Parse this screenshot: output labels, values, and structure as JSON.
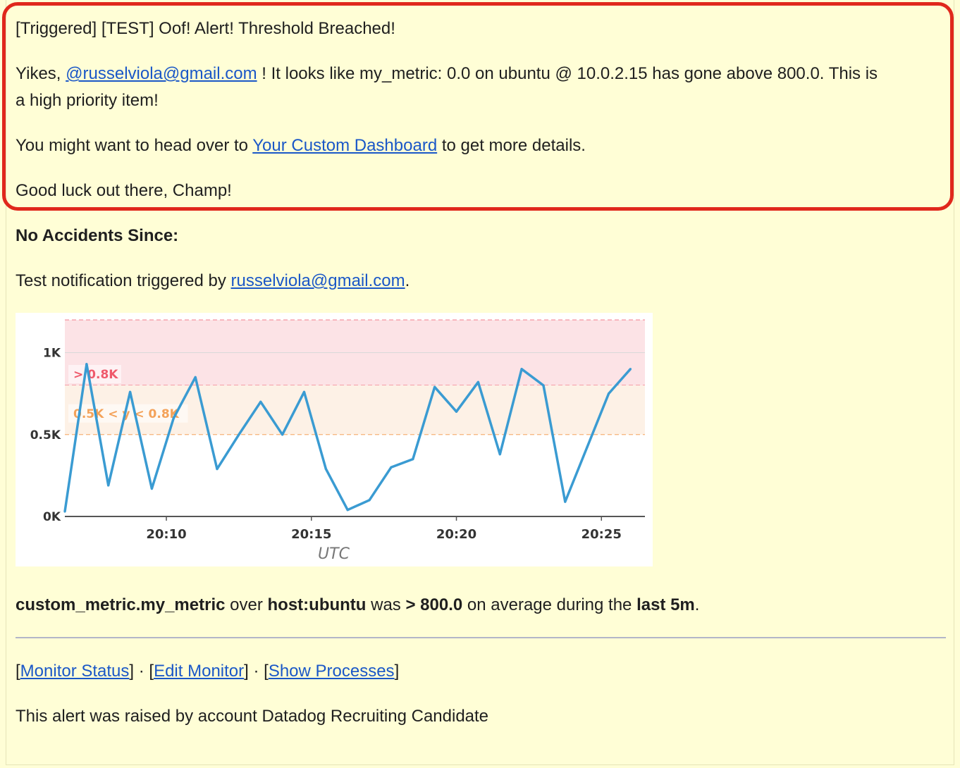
{
  "email": {
    "subject": "[Triggered] [TEST] Oof! Alert! Threshold Breached!",
    "p1_prefix": "Yikes, ",
    "p1_mention": "@russelviola@gmail.com",
    "p1_suffix_a": " ! It looks like my_metric: 0.0 on ubuntu @ 10.0.2.15 has gone above 800.0. This is",
    "p1_suffix_b": "a high priority item!",
    "p2_prefix": "You might want to head over to ",
    "p2_link": "Your Custom Dashboard",
    "p2_suffix": " to get more details.",
    "p3": "Good luck out there, Champ!",
    "heading": "No Accidents Since:",
    "test_prefix": "Test notification triggered by ",
    "test_link": "russelviola@gmail.com",
    "test_suffix": ".",
    "summary": {
      "metric": "custom_metric.my_metric",
      "over": " over ",
      "host": "host:ubuntu",
      "was": " was ",
      "threshold": "> 800.0",
      "on_avg": " on average during the ",
      "window": "last 5m",
      "end": "."
    },
    "links": {
      "open1": "[",
      "monitor_status": "Monitor Status",
      "close1": "] · [",
      "edit_monitor": "Edit Monitor",
      "close2": "] · [",
      "show_processes": "Show Processes",
      "close3": "]"
    },
    "footer": "This alert was raised by account Datadog Recruiting Candidate"
  },
  "colors": {
    "link": "#1a57c7",
    "highlight_border": "#e0281c",
    "background": "#fffed6",
    "line": "#3a9bd2",
    "alert_band": "#fce3e6",
    "warn_band": "#fdf1e6",
    "alert_text": "#ef5a6c",
    "warn_text": "#f4a259"
  },
  "chart_data": {
    "type": "line",
    "x_axis_label": "UTC",
    "x_ticks": [
      "20:10",
      "20:15",
      "20:20",
      "20:25"
    ],
    "y_ticks": [
      "0K",
      "0.5K",
      "1K"
    ],
    "ylim": [
      0,
      1200
    ],
    "xlim_minutes": [
      6.5,
      26.5
    ],
    "thresholds": [
      {
        "label": "> 0.8K",
        "from": 800,
        "to": 1200,
        "kind": "alert"
      },
      {
        "label": "0.5K < y < 0.8K",
        "from": 500,
        "to": 800,
        "kind": "warning"
      }
    ],
    "series": [
      {
        "x": [
          "20:06:30",
          "20:07:15",
          "20:08:00",
          "20:08:45",
          "20:09:30",
          "20:10:15",
          "20:11:00",
          "20:11:45",
          "20:12:30",
          "20:13:15",
          "20:14:00",
          "20:14:45",
          "20:15:30",
          "20:16:15",
          "20:17:00",
          "20:17:45",
          "20:18:30",
          "20:19:15",
          "20:20:00",
          "20:20:45",
          "20:21:30",
          "20:22:15",
          "20:23:00",
          "20:23:45",
          "20:24:30",
          "20:25:15",
          "20:26:00"
        ],
        "values": [
          30,
          930,
          190,
          760,
          170,
          600,
          850,
          290,
          500,
          700,
          500,
          760,
          290,
          40,
          100,
          300,
          350,
          790,
          640,
          820,
          380,
          900,
          800,
          90,
          420,
          750,
          900
        ]
      }
    ]
  }
}
